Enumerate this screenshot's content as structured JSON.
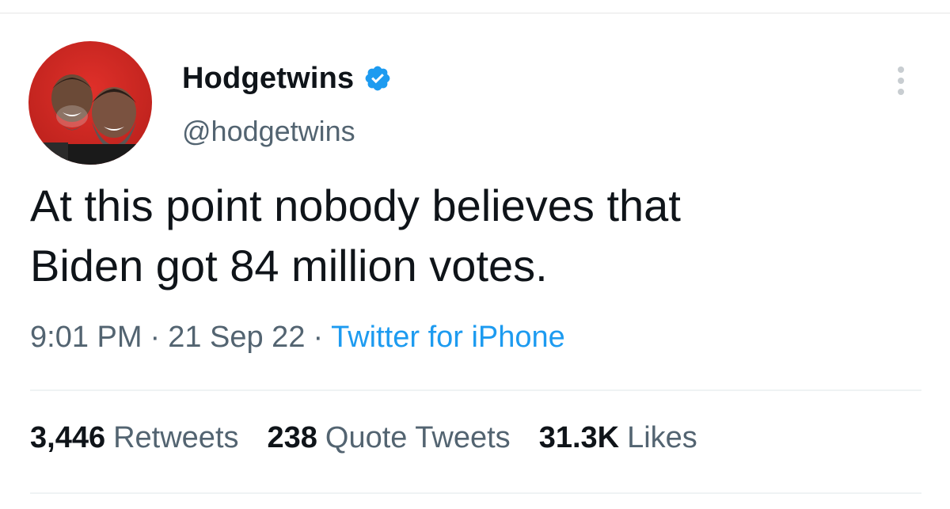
{
  "user": {
    "display_name": "Hodgetwins",
    "handle": "@hodgetwins",
    "verified": true
  },
  "tweet": {
    "text_line1": "At this point nobody believes that",
    "text_line2": "Biden got 84 million votes."
  },
  "meta": {
    "time": "9:01 PM",
    "separator": "·",
    "date": "21 Sep 22",
    "source": "Twitter for iPhone"
  },
  "stats": {
    "retweets_count": "3,446",
    "retweets_label": "Retweets",
    "quotes_count": "238",
    "quotes_label": "Quote Tweets",
    "likes_count": "31.3K",
    "likes_label": "Likes"
  },
  "colors": {
    "accent": "#1d9bf0",
    "secondary_text": "#536471",
    "primary_text": "#0f1419"
  },
  "icons": {
    "verified": "verified-badge-icon",
    "more": "more-options-icon"
  }
}
